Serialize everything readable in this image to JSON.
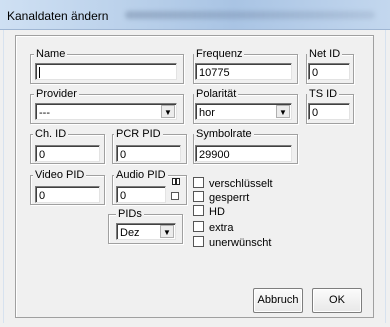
{
  "window": {
    "title": "Kanaldaten ändern"
  },
  "groups": {
    "name": {
      "label": "Name",
      "value": ""
    },
    "frequenz": {
      "label": "Frequenz",
      "value": "10775"
    },
    "net_id": {
      "label": "Net ID",
      "value": "0"
    },
    "provider": {
      "label": "Provider",
      "selected": "---"
    },
    "polaritaet": {
      "label": "Polarität",
      "selected": "hor"
    },
    "ts_id": {
      "label": "TS ID",
      "value": "0"
    },
    "ch_id": {
      "label": "Ch. ID",
      "value": "0"
    },
    "pcr_pid": {
      "label": "PCR PID",
      "value": "0"
    },
    "symbolrate": {
      "label": "Symbolrate",
      "value": "29900"
    },
    "video_pid": {
      "label": "Video PID",
      "value": "0"
    },
    "audio_pid": {
      "label": "Audio PID",
      "value": "0"
    },
    "pids": {
      "label": "PIDs",
      "selected": "Dez"
    }
  },
  "checkboxes": [
    {
      "label": "verschlüsselt",
      "checked": false
    },
    {
      "label": "gesperrt",
      "checked": false
    },
    {
      "label": "HD",
      "checked": false
    },
    {
      "label": "extra",
      "checked": false
    },
    {
      "label": "unerwünscht",
      "checked": false
    }
  ],
  "buttons": {
    "cancel": "Abbruch",
    "ok": "OK"
  },
  "icons": {
    "dropdown_arrow": "▼"
  }
}
